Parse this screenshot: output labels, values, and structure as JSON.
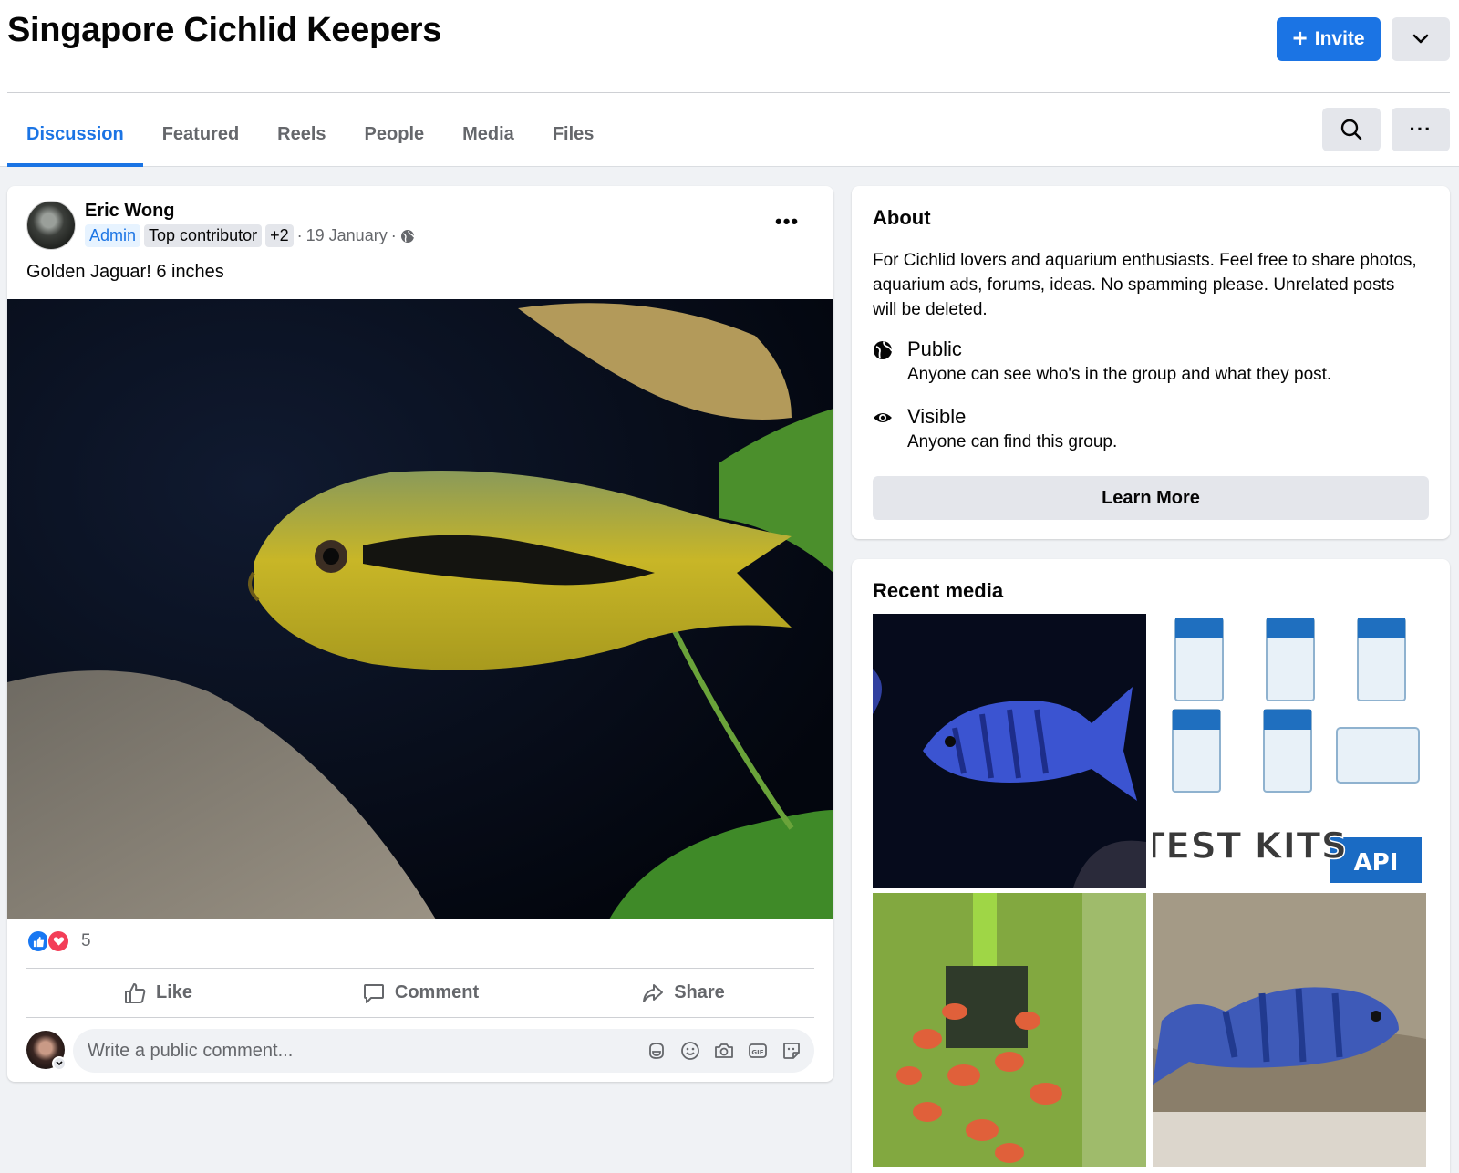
{
  "group": {
    "name": "Singapore Cichlid Keepers",
    "invite_label": "Invite"
  },
  "tabs": [
    {
      "label": "Discussion",
      "active": true
    },
    {
      "label": "Featured"
    },
    {
      "label": "Reels"
    },
    {
      "label": "People"
    },
    {
      "label": "Media"
    },
    {
      "label": "Files"
    }
  ],
  "post": {
    "author": "Eric Wong",
    "badges": [
      "Admin",
      "Top contributor",
      "+2"
    ],
    "date": "19 January",
    "text": "Golden Jaguar! 6 inches",
    "reaction_count": "5",
    "actions": {
      "like": "Like",
      "comment": "Comment",
      "share": "Share"
    },
    "comment_placeholder": "Write a public comment..."
  },
  "about": {
    "title": "About",
    "description": "For Cichlid lovers and aquarium enthusiasts. Feel free to share photos, aquarium ads, forums, ideas. No spamming please. Unrelated posts will be deleted.",
    "privacy": {
      "title": "Public",
      "subtitle": "Anyone can see who's in the group and what they post."
    },
    "visibility": {
      "title": "Visible",
      "subtitle": "Anyone can find this group."
    },
    "learn_more": "Learn More"
  },
  "recent_media": {
    "title": "Recent media",
    "thumb2_text": "TEST KITS",
    "thumb2_brand": "API"
  },
  "colors": {
    "accent": "#1b74e4",
    "like": "#1877f2",
    "love": "#f33e58"
  }
}
